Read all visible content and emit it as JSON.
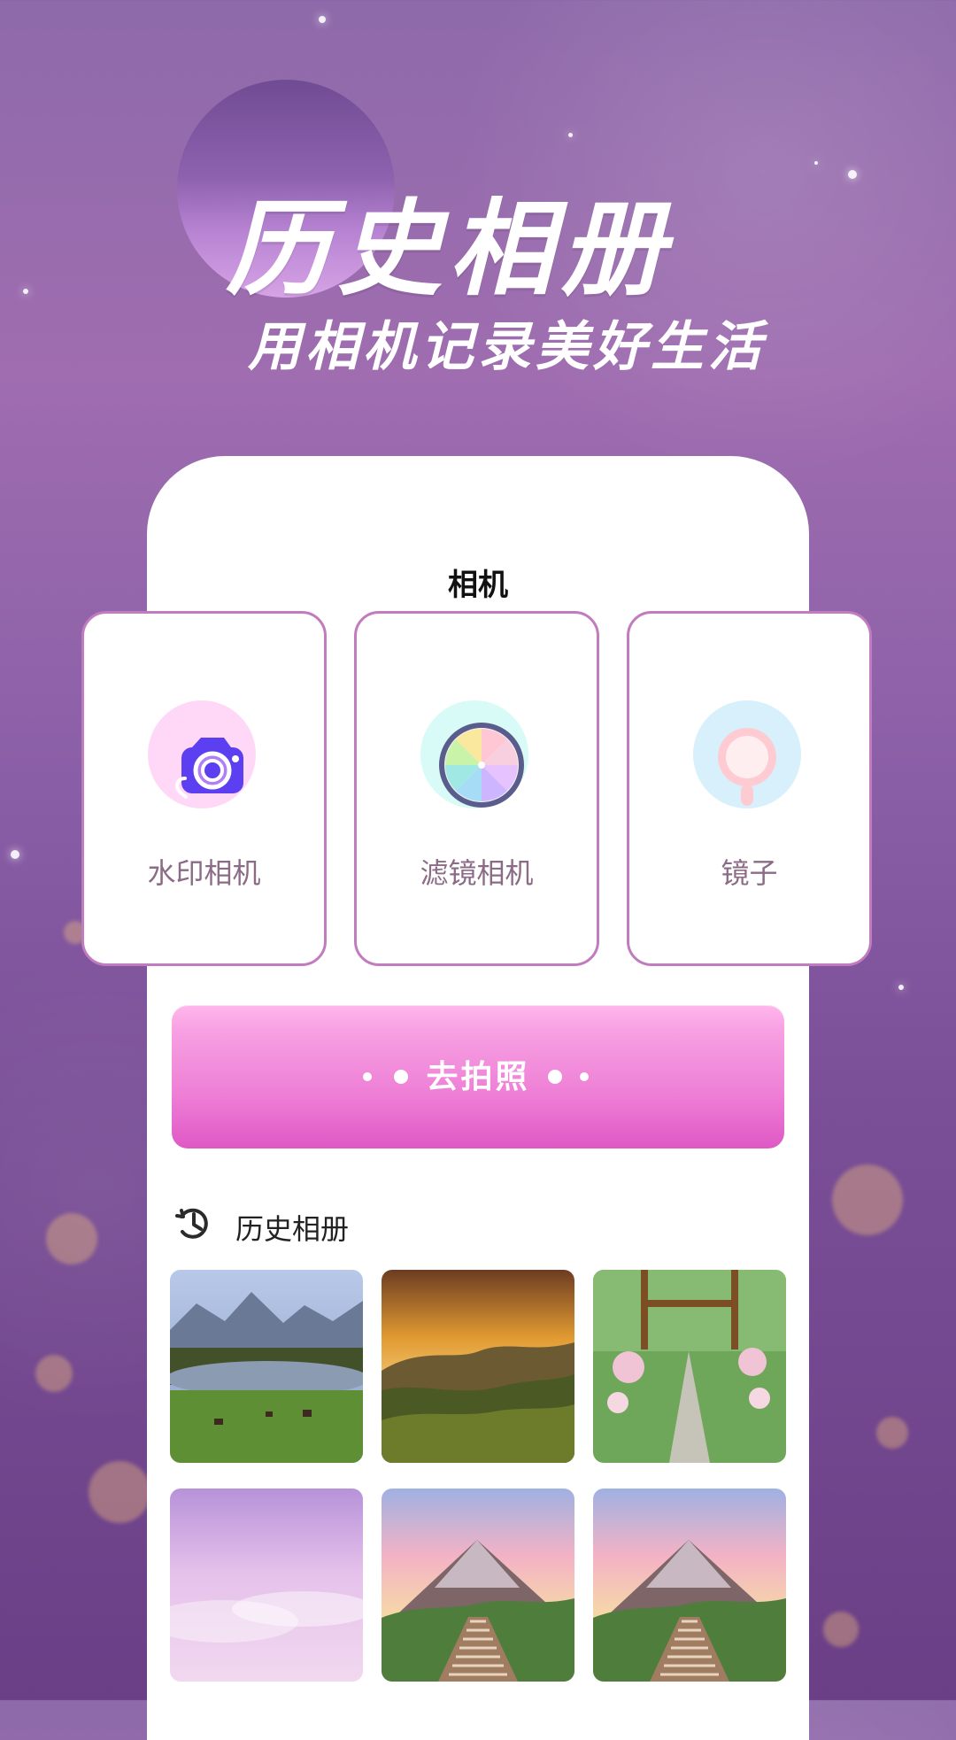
{
  "hero": {
    "title": "历史相册",
    "subtitle": "用相机记录美好生活"
  },
  "camera_section": {
    "label": "相机",
    "cards": [
      {
        "label": "水印相机",
        "icon": "camera-icon",
        "accent": "#ffd8f7"
      },
      {
        "label": "滤镜相机",
        "icon": "filter-wheel-icon",
        "accent": "#d8fbf7"
      },
      {
        "label": "镜子",
        "icon": "mirror-icon",
        "accent": "#d7f0fb"
      }
    ]
  },
  "cta": {
    "label": "去拍照"
  },
  "history": {
    "label": "历史相册",
    "icon": "history-icon",
    "thumbs": [
      {
        "name": "lake-meadow-thumb"
      },
      {
        "name": "sunset-hills-thumb"
      },
      {
        "name": "garden-path-thumb"
      },
      {
        "name": "pastel-sky-thumb"
      },
      {
        "name": "mountain-boardwalk-thumb-1"
      },
      {
        "name": "mountain-boardwalk-thumb-2"
      }
    ]
  },
  "colors": {
    "accent_pink": "#ee7fd6",
    "card_border": "#c17bbf",
    "label_purple": "#8b6b85"
  }
}
